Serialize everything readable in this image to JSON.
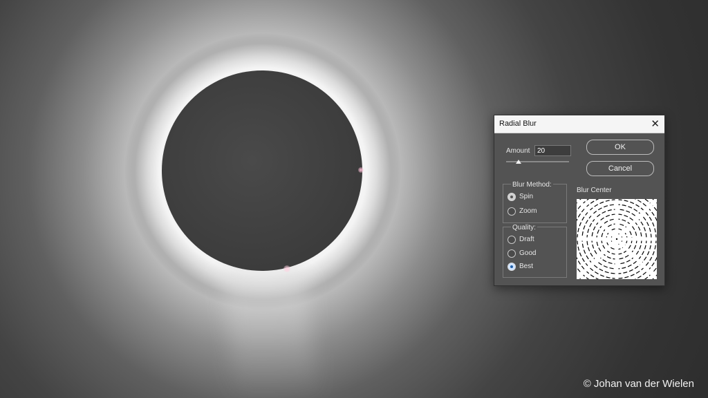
{
  "credit": "© Johan van der Wielen",
  "dialog": {
    "title": "Radial Blur",
    "close_icon": "close-icon",
    "amount": {
      "label": "Amount",
      "value": "20",
      "slider_fraction": 0.2
    },
    "buttons": {
      "ok": "OK",
      "cancel": "Cancel"
    },
    "blur_method": {
      "label": "Blur Method:",
      "options": [
        "Spin",
        "Zoom"
      ],
      "selected": "Spin"
    },
    "quality": {
      "label": "Quality:",
      "options": [
        "Draft",
        "Good",
        "Best"
      ],
      "selected": "Best"
    },
    "blur_center": {
      "label": "Blur Center"
    }
  },
  "colors": {
    "dialog_bg": "#535353",
    "titlebar_bg": "#f5f5f5",
    "radio_selected": "#1f5fa8"
  }
}
